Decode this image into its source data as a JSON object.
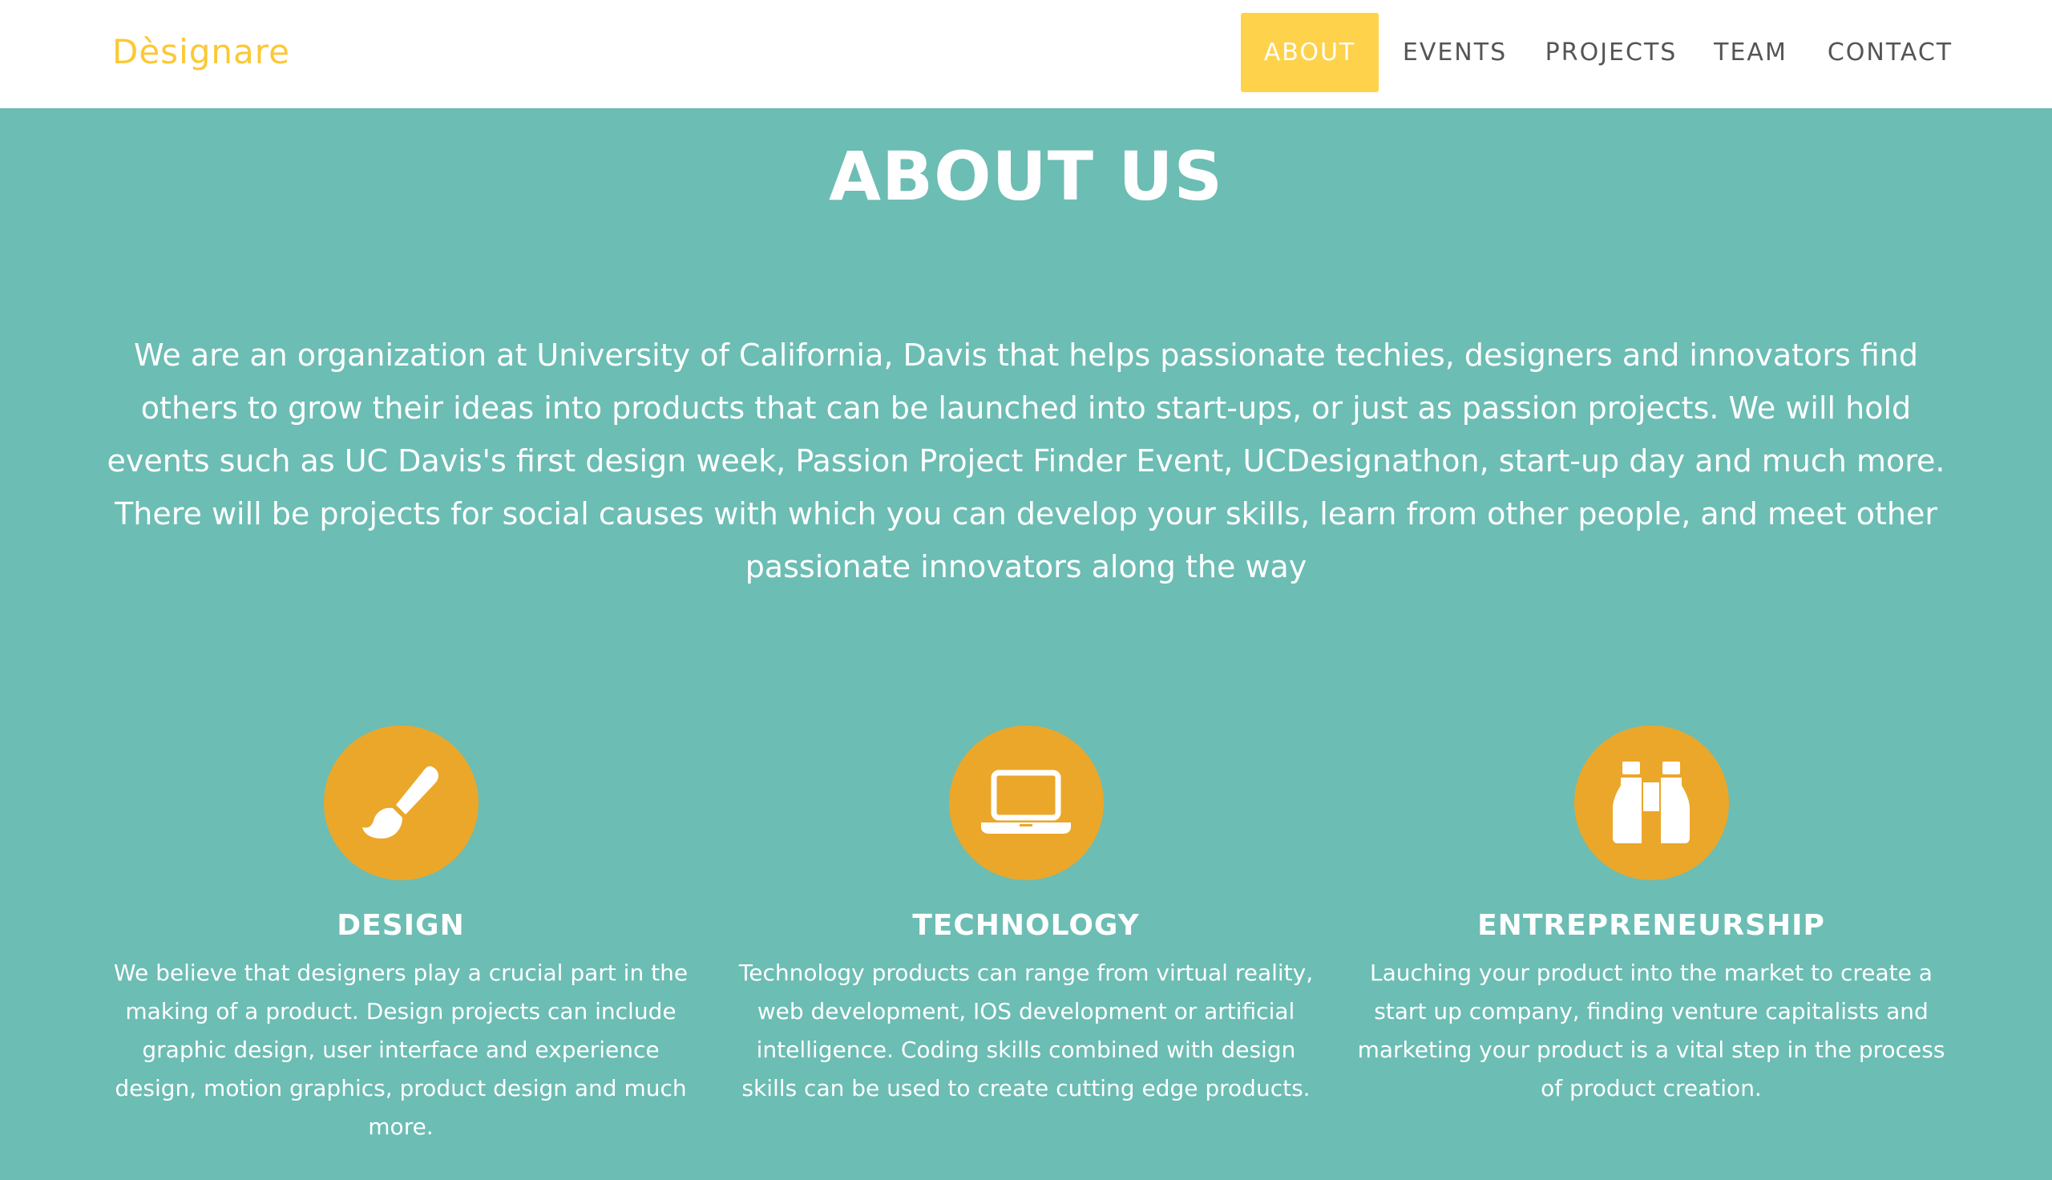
{
  "brand": "Dèsignare",
  "nav": {
    "items": [
      "ABOUT",
      "EVENTS",
      "PROJECTS",
      "TEAM",
      "CONTACT"
    ],
    "active_index": 0
  },
  "about": {
    "title": "ABOUT US",
    "text": "We are an organization at University of California, Davis that helps passionate techies, designers and innovators find others to grow their ideas into products that can be launched into start-ups, or just as passion projects. We will hold events such as UC Davis's first design week, Passion Project Finder Event, UCDesignathon, start-up day and much more. There will be projects for social causes with which you can develop your skills, learn from other people, and meet other passionate innovators along the way"
  },
  "features": [
    {
      "icon": "paintbrush-icon",
      "title": "DESIGN",
      "text": "We believe that designers play a crucial part in the making of a product. Design projects can include graphic design, user interface and experience design, motion graphics, product design and much more."
    },
    {
      "icon": "laptop-icon",
      "title": "TECHNOLOGY",
      "text": "Technology products can range from virtual reality, web development, IOS development or artificial intelligence. Coding skills combined with design skills can be used to create cutting edge products."
    },
    {
      "icon": "binoculars-icon",
      "title": "ENTREPRENEURSHIP",
      "text": "Lauching your product into the market to create a start up company, finding venture capitalists and marketing your product is a vital step in the process of product creation."
    }
  ],
  "colors": {
    "background": "#6cbdb4",
    "brand": "#fcc834",
    "nav_active": "#fed24b",
    "icon_circle": "#eba72a",
    "nav_text": "#555555"
  }
}
